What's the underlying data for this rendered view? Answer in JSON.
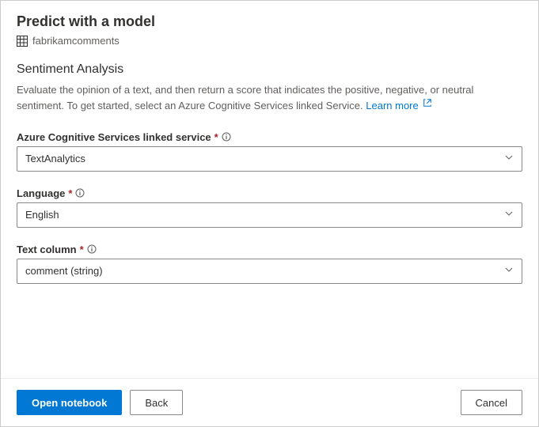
{
  "header": {
    "title": "Predict with a model",
    "tableName": "fabrikamcomments"
  },
  "section": {
    "title": "Sentiment Analysis",
    "description": "Evaluate the opinion of a text, and then return a score that indicates the positive, negative, or neutral sentiment. To get started, select an Azure Cognitive Services linked Service. ",
    "learnMore": "Learn more"
  },
  "fields": {
    "linkedService": {
      "label": "Azure Cognitive Services linked service",
      "value": "TextAnalytics"
    },
    "language": {
      "label": "Language",
      "value": "English"
    },
    "textColumn": {
      "label": "Text column",
      "value": "comment (string)"
    }
  },
  "footer": {
    "openNotebook": "Open notebook",
    "back": "Back",
    "cancel": "Cancel"
  }
}
